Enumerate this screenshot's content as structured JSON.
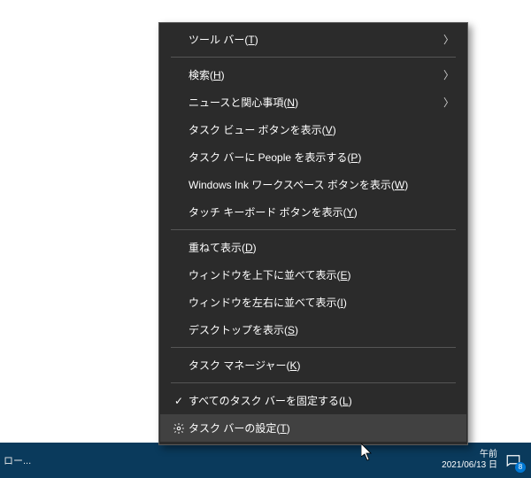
{
  "taskbar": {
    "left_text": "ロー...",
    "time_line1": "午前",
    "time_line2": "2021/06/13 日",
    "notification_badge": "8"
  },
  "menu": {
    "items": [
      {
        "label": "ツール バー",
        "accel": "T",
        "submenu": true,
        "checked": false,
        "icon": null
      },
      {
        "separator": true
      },
      {
        "label": "検索",
        "accel": "H",
        "submenu": true,
        "checked": false,
        "icon": null
      },
      {
        "label": "ニュースと関心事項",
        "accel": "N",
        "submenu": true,
        "checked": false,
        "icon": null
      },
      {
        "label": "タスク ビュー ボタンを表示",
        "accel": "V",
        "submenu": false,
        "checked": false,
        "icon": null
      },
      {
        "label": "タスク バーに People を表示する",
        "accel": "P",
        "submenu": false,
        "checked": false,
        "icon": null
      },
      {
        "label": "Windows Ink ワークスペース ボタンを表示",
        "accel": "W",
        "submenu": false,
        "checked": false,
        "icon": null
      },
      {
        "label": "タッチ キーボード ボタンを表示",
        "accel": "Y",
        "submenu": false,
        "checked": false,
        "icon": null
      },
      {
        "separator": true
      },
      {
        "label": "重ねて表示",
        "accel": "D",
        "submenu": false,
        "checked": false,
        "icon": null
      },
      {
        "label": "ウィンドウを上下に並べて表示",
        "accel": "E",
        "submenu": false,
        "checked": false,
        "icon": null
      },
      {
        "label": "ウィンドウを左右に並べて表示",
        "accel": "I",
        "submenu": false,
        "checked": false,
        "icon": null
      },
      {
        "label": "デスクトップを表示",
        "accel": "S",
        "submenu": false,
        "checked": false,
        "icon": null
      },
      {
        "separator": true
      },
      {
        "label": "タスク マネージャー",
        "accel": "K",
        "submenu": false,
        "checked": false,
        "icon": null
      },
      {
        "separator": true
      },
      {
        "label": "すべてのタスク バーを固定する",
        "accel": "L",
        "submenu": false,
        "checked": true,
        "icon": null
      },
      {
        "label": "タスク バーの設定",
        "accel": "T",
        "submenu": false,
        "checked": false,
        "icon": "gear",
        "hover": true
      }
    ]
  }
}
